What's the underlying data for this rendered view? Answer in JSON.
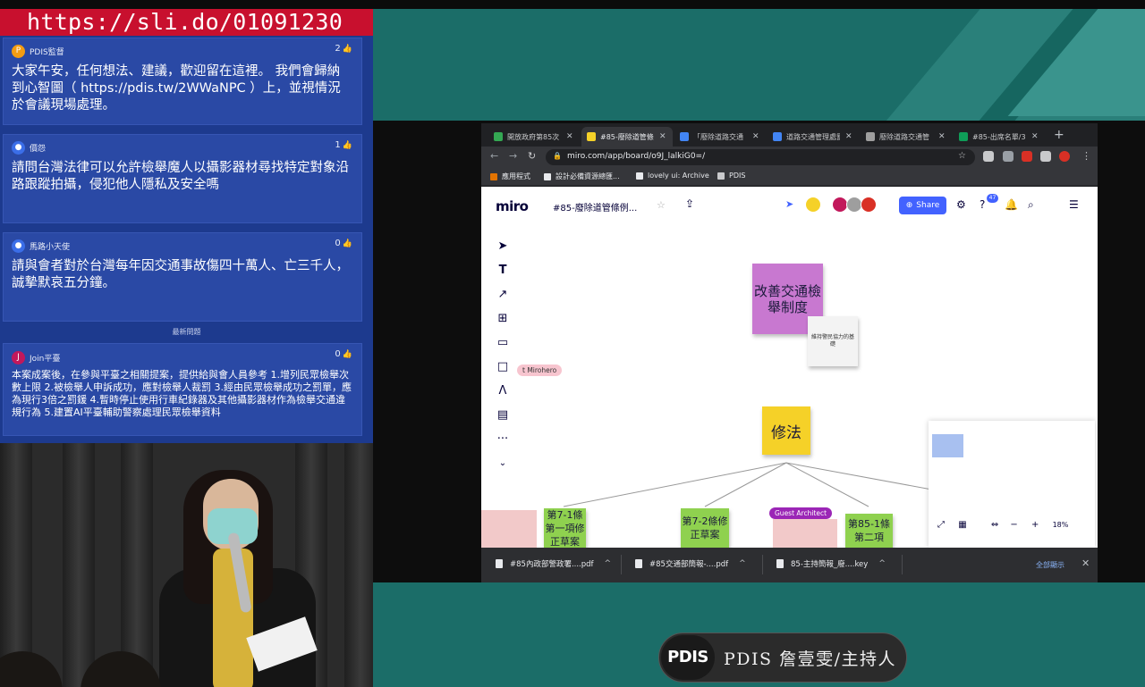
{
  "slido": {
    "join_url": "https://sli.do/01091230",
    "recent_label": "最新問題",
    "questions": [
      {
        "avatar": "P",
        "avatar_color": "#f39c12",
        "author": "PDIS監督",
        "likes": "2",
        "text": "大家午安，任何想法、建議，歡迎留在這裡。 我們會歸納到心智圖（ https://pdis.tw/2WWaNPC ）上，並視情況於會議現場處理。"
      },
      {
        "avatar": "👤",
        "avatar_color": "#3b6ee8",
        "author": "價怨",
        "likes": "1",
        "text": "請問台灣法律可以允許檢舉魔人以攝影器材尋找特定對象沿路跟蹤拍攝，侵犯他人隱私及安全嗎"
      },
      {
        "avatar": "👤",
        "avatar_color": "#3b6ee8",
        "author": "馬路小天使",
        "likes": "0",
        "text": "請與會者對於台灣每年因交通事故傷四十萬人、亡三千人，誠摯默哀五分鐘。"
      },
      {
        "avatar": "J",
        "avatar_color": "#c2185b",
        "author": "Join平臺",
        "likes": "0",
        "text": "本案成案後，在參與平臺之相關提案，提供給與會人員參考 1.增列民眾檢舉次數上限 2.被檢舉人申訴成功，應對檢舉人裁罰 3.經由民眾檢舉成功之罰單，應為現行3倍之罰鍰 4.暫時停止使用行車紀錄器及其他攝影器材作為檢舉交通違規行為 5.建置AI平臺輔助警察處理民眾檢舉資料"
      }
    ]
  },
  "browser": {
    "tabs": [
      {
        "label": "開放政府第85次",
        "fav_color": "#34a853",
        "active": false
      },
      {
        "label": "#85-廢除道管條",
        "fav_color": "#f5d128",
        "active": true
      },
      {
        "label": "「廢除道路交通",
        "fav_color": "#4285f4",
        "active": false
      },
      {
        "label": "道路交通管理處罰",
        "fav_color": "#4285f4",
        "active": false
      },
      {
        "label": "廢除道路交通管",
        "fav_color": "#9e9e9e",
        "active": false
      },
      {
        "label": "#85-出席名單/3",
        "fav_color": "#0f9d58",
        "active": false
      }
    ],
    "url": "miro.com/app/board/o9J_lalkiG0=/",
    "bookmarks": [
      "應用程式",
      "設計必備資源總匯...",
      "lovely ui: Archive",
      "PDIS"
    ],
    "downloads": [
      "#85內政部警政署....pdf",
      "#85交通部簡報-....pdf",
      "85-主持簡報_廢....key"
    ],
    "show_all": "全部顯示"
  },
  "miro": {
    "logo": "miro",
    "board_title": "#85-廢除道管條例...",
    "share_label": "Share",
    "notif_count": "47",
    "zoom": "18%",
    "sticky_main": "改善交通檢舉制度",
    "sticky_small": "維持警民協力的基礎",
    "sticky_law": "修法",
    "green_notes": [
      "第7-1條第一項修正草案",
      "第7-2條修正草案",
      "第85-1條第二項"
    ],
    "tag_pink": "t Mirohero",
    "tag_purple": "Guest Architect",
    "colors": {
      "accent": "#4262ff",
      "sticky_purple": "#c878d0",
      "sticky_yellow": "#f5d128",
      "sticky_green": "#8fd14f"
    }
  },
  "overlay": {
    "pdis_logo": "PDIS",
    "caption": "PDIS 詹壹雯/主持人"
  }
}
